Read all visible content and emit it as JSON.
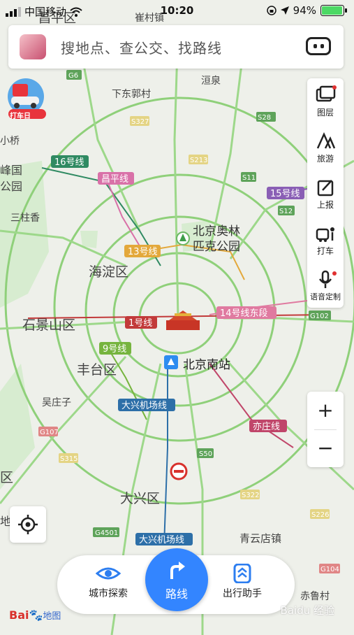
{
  "status": {
    "carrier": "中国移动",
    "time": "10:20",
    "battery": "94%"
  },
  "search": {
    "placeholder": "搜地点、查公交、找路线"
  },
  "promo": {
    "label": "打车日"
  },
  "right_tools": [
    {
      "label": "图层",
      "icon": "layers-icon"
    },
    {
      "label": "旅游",
      "icon": "travel-icon"
    },
    {
      "label": "上报",
      "icon": "report-icon"
    },
    {
      "label": "打车",
      "icon": "taxi-icon"
    },
    {
      "label": "语音定制",
      "icon": "mic-icon"
    }
  ],
  "zoom": {
    "in": "+",
    "out": "−"
  },
  "bottom_nav": {
    "explore": "城市探索",
    "route": "路线",
    "assistant": "出行助手"
  },
  "logo": {
    "bai": "Bai",
    "du": "地图"
  },
  "watermark": "Baidu 经验",
  "map": {
    "places": [
      {
        "text": "昌平区"
      },
      {
        "text": "崔村镇"
      },
      {
        "text": "下东郭村"
      },
      {
        "text": "洹泉"
      },
      {
        "text": "小桥"
      },
      {
        "text": "峰国"
      },
      {
        "text": "公园"
      },
      {
        "text": "三柱香"
      },
      {
        "text": "北京奥林"
      },
      {
        "text": "匹克公园"
      },
      {
        "text": "海淀区"
      },
      {
        "text": "石景山区"
      },
      {
        "text": "北京南站"
      },
      {
        "text": "丰台区"
      },
      {
        "text": "吴庄子"
      },
      {
        "text": "大兴区"
      },
      {
        "text": "青云店镇"
      },
      {
        "text": "赤鲁村"
      },
      {
        "text": "区"
      },
      {
        "text": "地"
      }
    ],
    "lines": [
      {
        "text": "16号线",
        "color": "#2f8a62"
      },
      {
        "text": "昌平线",
        "color": "#d971a8"
      },
      {
        "text": "13号线",
        "color": "#e3a83b"
      },
      {
        "text": "15号线",
        "color": "#8a5fb5"
      },
      {
        "text": "14号线东段",
        "color": "#e07aa0"
      },
      {
        "text": "1号线",
        "color": "#c23a3a"
      },
      {
        "text": "9号线",
        "color": "#76b43e"
      },
      {
        "text": "大兴机场线",
        "color": "#2d6fa8"
      },
      {
        "text": "亦庄线",
        "color": "#c0466a"
      },
      {
        "text": "大兴机场线",
        "color": "#2d6fa8"
      }
    ],
    "shields": [
      {
        "text": "G6"
      },
      {
        "text": "S327"
      },
      {
        "text": "S213"
      },
      {
        "text": "S28"
      },
      {
        "text": "S11"
      },
      {
        "text": "S12"
      },
      {
        "text": "G102"
      },
      {
        "text": "S50"
      },
      {
        "text": "S322"
      },
      {
        "text": "S226"
      },
      {
        "text": "G4501"
      },
      {
        "text": "G107"
      },
      {
        "text": "S315"
      },
      {
        "text": "G104"
      }
    ]
  }
}
